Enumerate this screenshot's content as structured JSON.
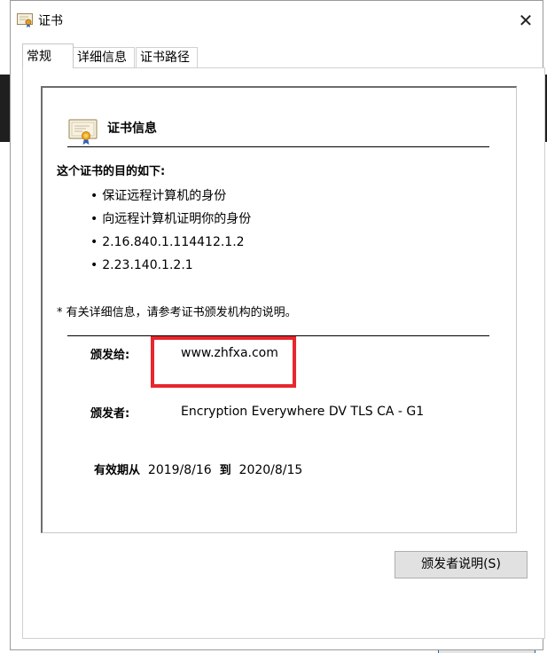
{
  "window": {
    "title": "证书",
    "close_glyph": "✕"
  },
  "tabs": [
    {
      "label": "常规",
      "active": true
    },
    {
      "label": "详细信息",
      "active": false
    },
    {
      "label": "证书路径",
      "active": false
    }
  ],
  "general": {
    "section_title": "证书信息",
    "purpose_heading": "这个证书的目的如下:",
    "purposes": [
      "保证远程计算机的身份",
      "向远程计算机证明你的身份",
      "2.16.840.1.114412.1.2",
      "2.23.140.1.2.1"
    ],
    "note": "* 有关详细信息，请参考证书颁发机构的说明。",
    "issued_to_label": "颁发给:",
    "issued_to_value": "www.zhfxa.com",
    "issued_by_label": "颁发者:",
    "issued_by_value": "Encryption Everywhere DV TLS CA - G1",
    "valid_from_label": "有效期从",
    "valid_from": "2019/8/16",
    "valid_to_label": "到",
    "valid_to": "2020/8/15",
    "issuer_statement_button": "颁发者说明(S)"
  },
  "icons": {
    "title": "certificate-icon",
    "section": "certificate-icon"
  },
  "colors": {
    "highlight_border": "#e8262d",
    "button_bg": "#e1e1e1"
  }
}
